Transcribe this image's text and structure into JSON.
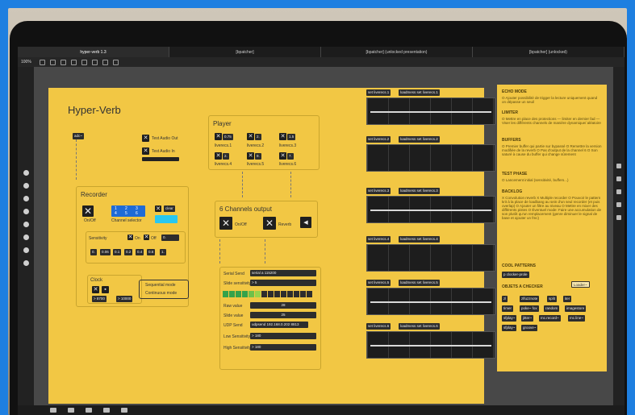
{
  "tabs": [
    {
      "label": "hyper-verb 1.3",
      "active": true
    },
    {
      "label": "[bpatcher]",
      "active": false
    },
    {
      "label": "[bpatcher] (unlocked presentation)",
      "active": false
    },
    {
      "label": "[bpatcher] (unlocked)",
      "active": false
    }
  ],
  "toolbar": {
    "zoom": "100%"
  },
  "patch": {
    "title": "Hyper-Verb",
    "adc_label": "adc~",
    "test_audio_out": "Test Audio Out",
    "test_audio_in": "Test Audio In",
    "recorder": {
      "title": "Recorder",
      "onoff": "On/Off",
      "channel_selector": "Channel selector",
      "channels": [
        "1",
        "2",
        "3",
        "4",
        "5",
        "6"
      ],
      "clear": "clear",
      "sensitivity": "Sensitivity",
      "on": "On",
      "off": "Off",
      "sens_value": "0.",
      "sens_presets": [
        "0.",
        "0.06",
        "0.1",
        "0.2",
        "0.4",
        "0.6",
        "1."
      ],
      "clock": {
        "title": "Clock",
        "val1": "> 8700",
        "val2": "> 10000",
        "sequential": "Sequential mode",
        "continuous": "Continuous mode"
      }
    },
    "player": {
      "title": "Player",
      "items": [
        {
          "value": "0.75",
          "label": "liverecs.1"
        },
        {
          "value": "2.",
          "label": "liverecs.2"
        },
        {
          "value": "1.5",
          "label": "liverecs.3"
        },
        {
          "value": "2.",
          "label": "liverecs.4"
        },
        {
          "value": "9.",
          "label": "liverecs.5"
        },
        {
          "value": "7.",
          "label": "liverecs.6"
        }
      ]
    },
    "output": {
      "title": "6 Channels output",
      "onoff": "On/Off",
      "reverb": "Reverb"
    },
    "serial": {
      "serial_send": "Serial Send",
      "serial_msg": "serial a 115200",
      "slide_sensitivity": "Slide sensitivity",
      "slide_sens_val": "> 5",
      "raw_value": "Raw value",
      "raw_val": "28",
      "slide_value": "Slide value",
      "slide_val": "25",
      "udp_send": "UDP Send",
      "udp_msg": "udpsend 192.168.0.202 8813",
      "low_sens": "Low Sensitivity",
      "low_val": "> 180",
      "high_sens": "High Sensitivity",
      "high_val": "> 180"
    },
    "waveforms": [
      {
        "set": "set liverecs.1",
        "load": "loadmess set liverecs.1"
      },
      {
        "set": "set liverecs.2",
        "load": "loadmess set liverecs.2"
      },
      {
        "set": "set liverecs.3",
        "load": "loadmess set liverecs.3"
      },
      {
        "set": "set liverecs.4",
        "load": "loadmess set liverecs.4"
      },
      {
        "set": "set liverecs.5",
        "load": "loadmess set liverecs.5"
      },
      {
        "set": "set liverecs.6",
        "load": "loadmess set liverecs.6"
      }
    ]
  },
  "notes": {
    "echo_title": "ECHO MODE",
    "echo_text": "O Ajouter possibilité de trigger la lecture uniquement quand on dépasse un seuil",
    "limiter_title": "LIMITER",
    "limiter_text": "O Mettre en place des protections — limiter en dernier fad — Viser les différents channels de manière dynamique/ aléatoire",
    "buffers_title": "BUFFERS",
    "buffers_text": "O Premier buffer qui partie sur bypassé O Remettre la version modifiée de la reverb O Pas d'output de la channel 6 O Son saturé à cause du buffer qui change sûrement",
    "test_title": "TEST PHASE",
    "test_text": "O Lancement initial (sensitivité, buffers...)",
    "backlog_title": "BACKLOG",
    "backlog_text": "X Convolution reverb X Multiple recorder O Pouvoir le pattern krit à la place de loadbang au sein d'un seul recorder (et puis overlap) O Ajouter un filtre au niveau O Mettre en mixer des différents pistes O Éventuel mode: Faire une accumulation de son plutôt qu'un remplacement (genre diminuer le signal de base et ajouter un fmc)",
    "cool_title": "COOL PATTERNS",
    "cool_item": "p clocker-prole",
    "objets_title": "OBJETS A CHECKER",
    "objets_bubble": "Loader~",
    "objets": [
      "zl",
      "zlfuzznote",
      "split",
      "iter",
      "timer",
      "poke~ fox",
      "random",
      "imagestore",
      "sfplay~",
      "jitter~",
      "mc.record~",
      "mc.line~",
      "sfplay~",
      "groove~"
    ]
  },
  "colors": {
    "patch_bg": "#f2c744",
    "meter_green": "#35a24a",
    "accent_blue": "#1e7fe0"
  }
}
